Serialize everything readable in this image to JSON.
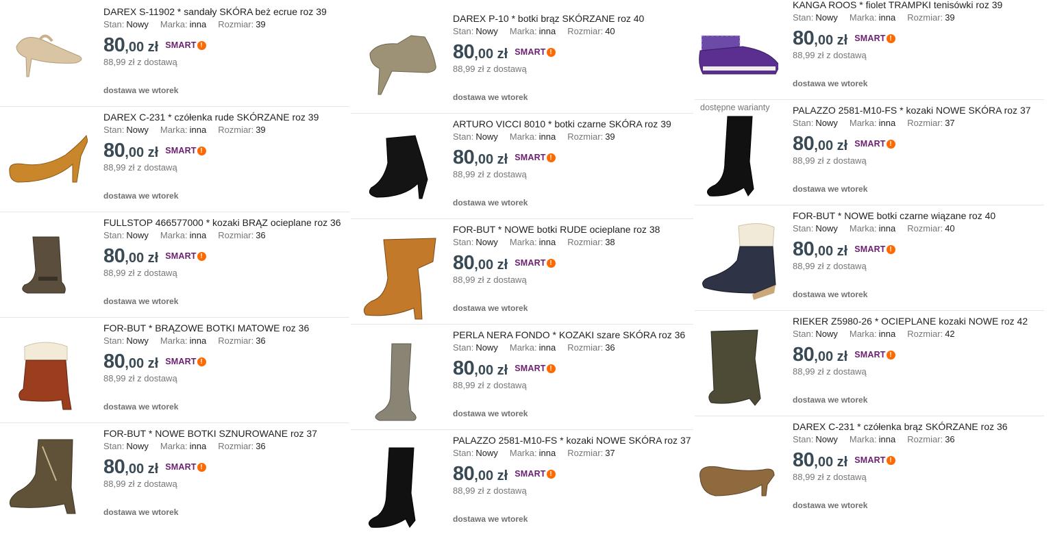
{
  "common": {
    "stan_label": "Stan:",
    "marka_label": "Marka:",
    "rozmiar_label": "Rozmiar:",
    "price_main": "80",
    "price_cents": ",00 zł",
    "smart_label": "SMART",
    "smart_mark": "!",
    "delivery_price": "88,99 zł z dostawą",
    "delivery_time": "dostawa we wtorek",
    "variants": "dostępne warianty"
  },
  "columns": [
    {
      "items": [
        {
          "title": "DAREX S-11902 * sandały SKÓRA beż ecrue roz 39",
          "stan": "Nowy",
          "marka": "inna",
          "rozmiar": "39",
          "image": "beige-sandal"
        },
        {
          "title": "DAREX C-231 * czółenka rude SKÓRZANE roz 39",
          "stan": "Nowy",
          "marka": "inna",
          "rozmiar": "39",
          "image": "tan-pump"
        },
        {
          "title": "FULLSTOP 466577000 * kozaki BRĄZ ocieplane roz 36",
          "stan": "Nowy",
          "marka": "inna",
          "rozmiar": "36",
          "image": "brown-mid-boot"
        },
        {
          "title": "FOR-BUT * BRĄZOWE BOTKI MATOWE roz 36",
          "stan": "Nowy",
          "marka": "inna",
          "rozmiar": "36",
          "image": "brown-fur-boot"
        },
        {
          "title": "FOR-BUT * NOWE BOTKI SZNUROWANE roz 37",
          "stan": "Nowy",
          "marka": "inna",
          "rozmiar": "36",
          "image": "olive-lace-boot"
        }
      ]
    },
    {
      "items": [
        {
          "title": "DAREX P-10 * botki brąz SKÓRZANE roz 40",
          "stan": "Nowy",
          "marka": "inna",
          "rozmiar": "40",
          "image": "taupe-ankle-boot"
        },
        {
          "title": "ARTURO VICCI 8010 * botki czarne SKÓRA roz 39",
          "stan": "Nowy",
          "marka": "inna",
          "rozmiar": "39",
          "image": "black-ankle-boot"
        },
        {
          "title": "FOR-BUT * NOWE botki RUDE ocieplane roz 38",
          "stan": "Nowy",
          "marka": "inna",
          "rozmiar": "38",
          "image": "tan-cuff-boot"
        },
        {
          "title": "PERLA NERA FONDO * KOZAKI szare SKÓRA roz 36",
          "stan": "Nowy",
          "marka": "inna",
          "rozmiar": "36",
          "image": "grey-tall-boot"
        },
        {
          "title": "PALAZZO 2581-M10-FS * kozaki NOWE SKÓRA roz 37",
          "stan": "Nowy",
          "marka": "inna",
          "rozmiar": "37",
          "image": "black-tall-boot"
        }
      ]
    },
    {
      "items": [
        {
          "title": "KANGA ROOS * fiolet TRAMPKI tenisówki roz 39",
          "stan": "Nowy",
          "marka": "inna",
          "rozmiar": "39",
          "image": "purple-sneaker",
          "variants": true
        },
        {
          "title": "PALAZZO 2581-M10-FS * kozaki NOWE SKÓRA roz 37",
          "stan": "Nowy",
          "marka": "inna",
          "rozmiar": "37",
          "image": "black-tall-boot"
        },
        {
          "title": "FOR-BUT * NOWE botki czarne wiązane roz 40",
          "stan": "Nowy",
          "marka": "inna",
          "rozmiar": "40",
          "image": "navy-fur-wedge"
        },
        {
          "title": "RIEKER Z5980-26 * OCIEPLANE kozaki NOWE roz 42",
          "stan": "Nowy",
          "marka": "inna",
          "rozmiar": "42",
          "image": "olive-slouch-boot"
        },
        {
          "title": "DAREX C-231 * czółenka brąz SKÓRZANE roz 36",
          "stan": "Nowy",
          "marka": "inna",
          "rozmiar": "36",
          "image": "brown-pump"
        }
      ]
    }
  ]
}
